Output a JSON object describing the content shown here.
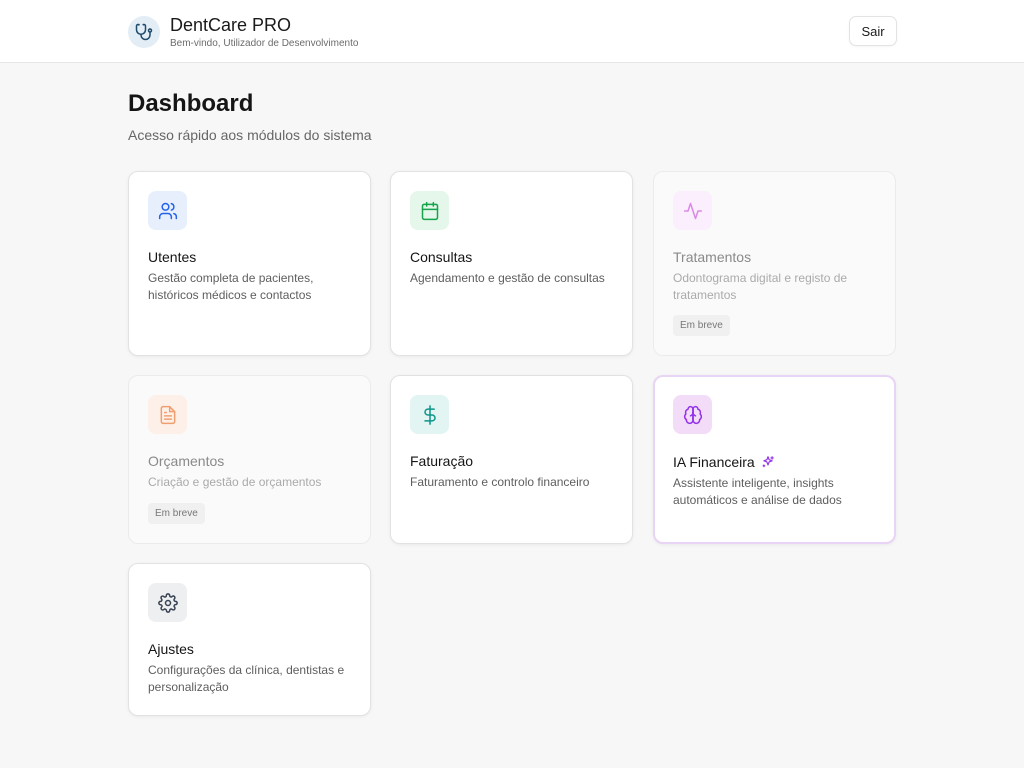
{
  "header": {
    "app_title": "DentCare PRO",
    "welcome": "Bem-vindo, Utilizador de Desenvolvimento",
    "logout_label": "Sair"
  },
  "main": {
    "title": "Dashboard",
    "subtitle": "Acesso rápido aos módulos do sistema"
  },
  "modules": [
    {
      "title": "Utentes",
      "description": "Gestão completa de pacientes, históricos médicos e contactos",
      "icon": "users-icon",
      "color": "#2563eb",
      "enabled": true
    },
    {
      "title": "Consultas",
      "description": "Agendamento e gestão de consultas",
      "icon": "calendar-icon",
      "color": "#16a34a",
      "enabled": true
    },
    {
      "title": "Tratamentos",
      "description": "Odontograma digital e registo de tratamentos",
      "icon": "activity-icon",
      "color": "#c026d3",
      "enabled": false,
      "badge": "Em breve"
    },
    {
      "title": "Orçamentos",
      "description": "Criação e gestão de orçamentos",
      "icon": "file-text-icon",
      "color": "#ea580c",
      "enabled": false,
      "badge": "Em breve"
    },
    {
      "title": "Faturação",
      "description": "Faturamento e controlo financeiro",
      "icon": "dollar-icon",
      "color": "#0d9488",
      "enabled": true
    },
    {
      "title": "IA Financeira",
      "description": "Assistente inteligente, insights automáticos e análise de dados",
      "icon": "brain-icon",
      "color": "#9333ea",
      "enabled": true
    },
    {
      "title": "Ajustes",
      "description": "Configurações da clínica, dentistas e personalização",
      "icon": "gear-icon",
      "color": "#374151",
      "enabled": true
    }
  ]
}
